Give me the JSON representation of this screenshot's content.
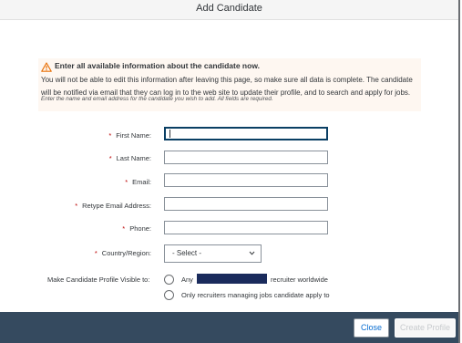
{
  "dialog": {
    "title": "Add Candidate"
  },
  "warning": {
    "icon": "warning-triangle-icon",
    "title": "Enter all available information about the candidate now.",
    "body": "You will not be able to edit this information after leaving this page, so make sure all data is complete. The candidate will be notified via email that they can log in to the web site to update their profile, and to search and apply for jobs."
  },
  "instructions": "Enter the name and email address for the candidate you wish to add. All fields are required.",
  "form": {
    "required_marker": "*",
    "first_name": {
      "label": "First Name:",
      "value": ""
    },
    "last_name": {
      "label": "Last Name:",
      "value": ""
    },
    "email": {
      "label": "Email:",
      "value": ""
    },
    "retype_email": {
      "label": "Retype Email Address:",
      "value": ""
    },
    "phone": {
      "label": "Phone:",
      "value": ""
    },
    "country": {
      "label": "Country/Region:",
      "selected": "- Select -"
    },
    "visibility": {
      "label": "Make Candidate Profile Visible to:",
      "option_any_prefix": "Any",
      "option_any_suffix": "recruiter worldwide",
      "option_own": "Only recruiters managing jobs candidate apply to"
    }
  },
  "footer": {
    "close_label": "Close",
    "create_label": "Create Profile"
  },
  "colors": {
    "accent": "#0a6ed1",
    "footer_bg": "#354a5f",
    "warning_bg": "#fef7f1",
    "required": "#bb0000"
  }
}
